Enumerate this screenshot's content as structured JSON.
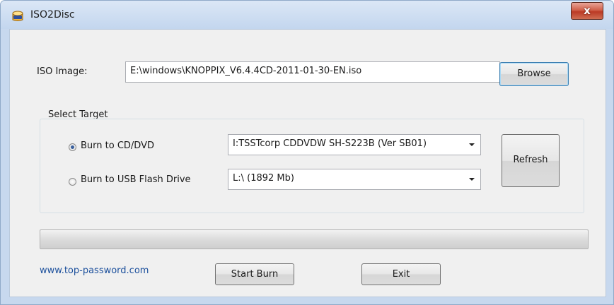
{
  "window": {
    "title": "ISO2Disc",
    "close_label": "x",
    "app_icon": "iso-disc-icon"
  },
  "iso": {
    "label": "ISO Image:",
    "path": "E:\\windows\\KNOPPIX_V6.4.4CD-2011-01-30-EN.iso",
    "browse_label": "Browse"
  },
  "target": {
    "group_label": "Select Target",
    "cd_label": "Burn to CD/DVD",
    "cd_selected": true,
    "cd_drive": "I:TSSTcorp CDDVDW SH-S223B (Ver SB01)",
    "usb_label": "Burn to USB Flash Drive",
    "usb_selected": false,
    "usb_drive": "L:\\ (1892 Mb)",
    "refresh_label": "Refresh"
  },
  "progress": {
    "value": 0
  },
  "footer": {
    "link_text": "www.top-password.com",
    "start_label": "Start Burn",
    "exit_label": "Exit"
  },
  "colors": {
    "title_bar": "#c7d8ee",
    "client_bg": "#f0f0f0",
    "close_button": "#c7432b",
    "link": "#1b4f9c"
  }
}
